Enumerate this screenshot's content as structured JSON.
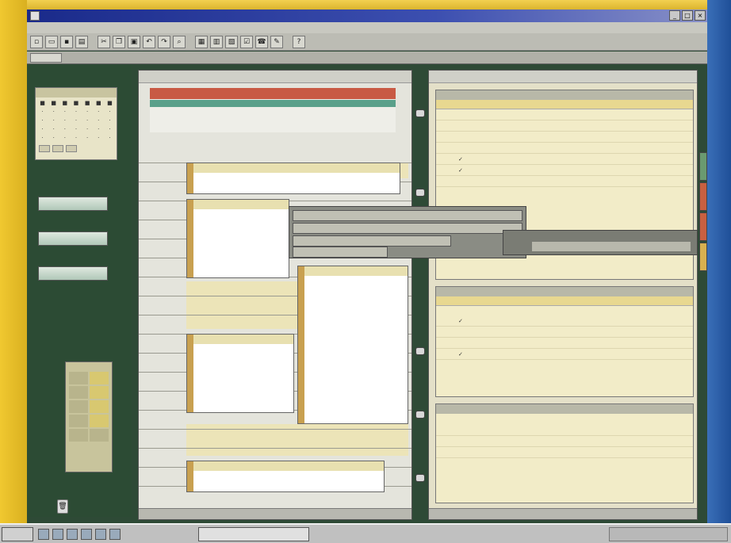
{
  "window": {
    "title": "",
    "minimize": "_",
    "maximize": "□",
    "close": "×"
  },
  "menu": [
    "",
    "",
    "",
    "",
    "",
    "",
    "",
    "",
    ""
  ],
  "toolbar2": {
    "label": ""
  },
  "minical": {
    "header": "",
    "days": [
      "",
      "",
      "",
      "",
      "",
      "",
      "",
      "",
      "",
      "",
      "",
      "",
      "",
      "",
      "",
      "",
      "",
      "",
      "",
      "",
      "",
      "",
      "",
      "",
      "",
      "",
      "",
      "",
      "",
      "",
      "",
      "",
      "",
      "",
      "",
      "",
      "",
      "",
      "",
      "",
      "",
      ""
    ]
  },
  "nav": {
    "btn1": "",
    "btn2": "",
    "btn3": ""
  },
  "palette": {
    "cells": [
      "",
      "",
      "",
      "",
      "",
      "",
      "",
      "",
      "",
      ""
    ]
  },
  "schedule": {
    "header_left": "",
    "header_right": "",
    "allday_red": "",
    "allday_teal": "",
    "allday_text": "",
    "hours": [
      "",
      "",
      "",
      "",
      "",
      "",
      "",
      "",
      "",
      "",
      "",
      "",
      "",
      "",
      "",
      "",
      "",
      ""
    ],
    "appt1_header": "",
    "appt1_text": "",
    "appt2_header": "",
    "appt3_header": "",
    "appt4_header": "",
    "appt4_text": "",
    "appt5_header": "",
    "appt5_text": "",
    "footer": ""
  },
  "popup": {
    "row1": "",
    "row2": "",
    "row3": "",
    "row4": "",
    "row5": ""
  },
  "right": {
    "header_left": "",
    "header_right": "",
    "todo": {
      "title": "",
      "cols": [
        "",
        "",
        ""
      ],
      "items": [
        {
          "check": "",
          "text": ""
        },
        {
          "check": "",
          "text": ""
        },
        {
          "check": "",
          "text": ""
        },
        {
          "check": "",
          "text": ""
        },
        {
          "check": "✓",
          "text": ""
        },
        {
          "check": "✓",
          "text": ""
        },
        {
          "check": "",
          "text": ""
        }
      ]
    },
    "contacts": {
      "title": "",
      "cols": [
        "",
        ""
      ],
      "items": [
        {
          "check": "✓",
          "name": "",
          "phone": ""
        },
        {
          "check": "",
          "name": "",
          "phone": ""
        },
        {
          "check": "",
          "name": "",
          "phone": ""
        },
        {
          "check": "✓",
          "name": "",
          "phone": ""
        }
      ]
    },
    "memo": {
      "title": "",
      "lines": [
        "",
        "",
        ""
      ]
    },
    "footer": ""
  },
  "taskbar": {
    "start": "",
    "task": "",
    "tray": ""
  }
}
